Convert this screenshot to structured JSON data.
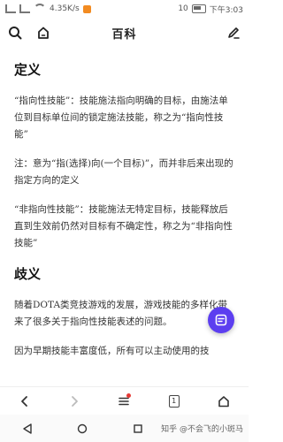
{
  "status_bar": {
    "network_label": "4.35K/s",
    "battery_label": "10",
    "time": "下午3:03"
  },
  "toolbar": {
    "title": "百科"
  },
  "article": {
    "section1_heading": "定义",
    "para1": "“指向性技能”：技能施法指向明确的目标，由施法单位到目标单位间的锁定施法技能，称之为“指向性技能”",
    "para2": "注：意为“指(选择)向(一个目标)”，而并非后来出现的指定方向的定义",
    "para3": "“非指向性技能”：技能施法无特定目标，技能释放后直到生效前仍然对目标有不确定性，称之为“非指向性技能”",
    "section2_heading": "歧义",
    "para4": "随着DOTA类竞技游戏的发展，游戏技能的多样化带来了很多关于指向性技能表述的问题。",
    "para5": "因为早期技能丰富度低，所有可以主动使用的技"
  },
  "bottom_nav": {
    "tab_count": "1"
  },
  "watermark": "知乎 @不会飞的小斑马",
  "colors": {
    "fab": "#5c3ef0",
    "notification_dot": "#e53935"
  }
}
